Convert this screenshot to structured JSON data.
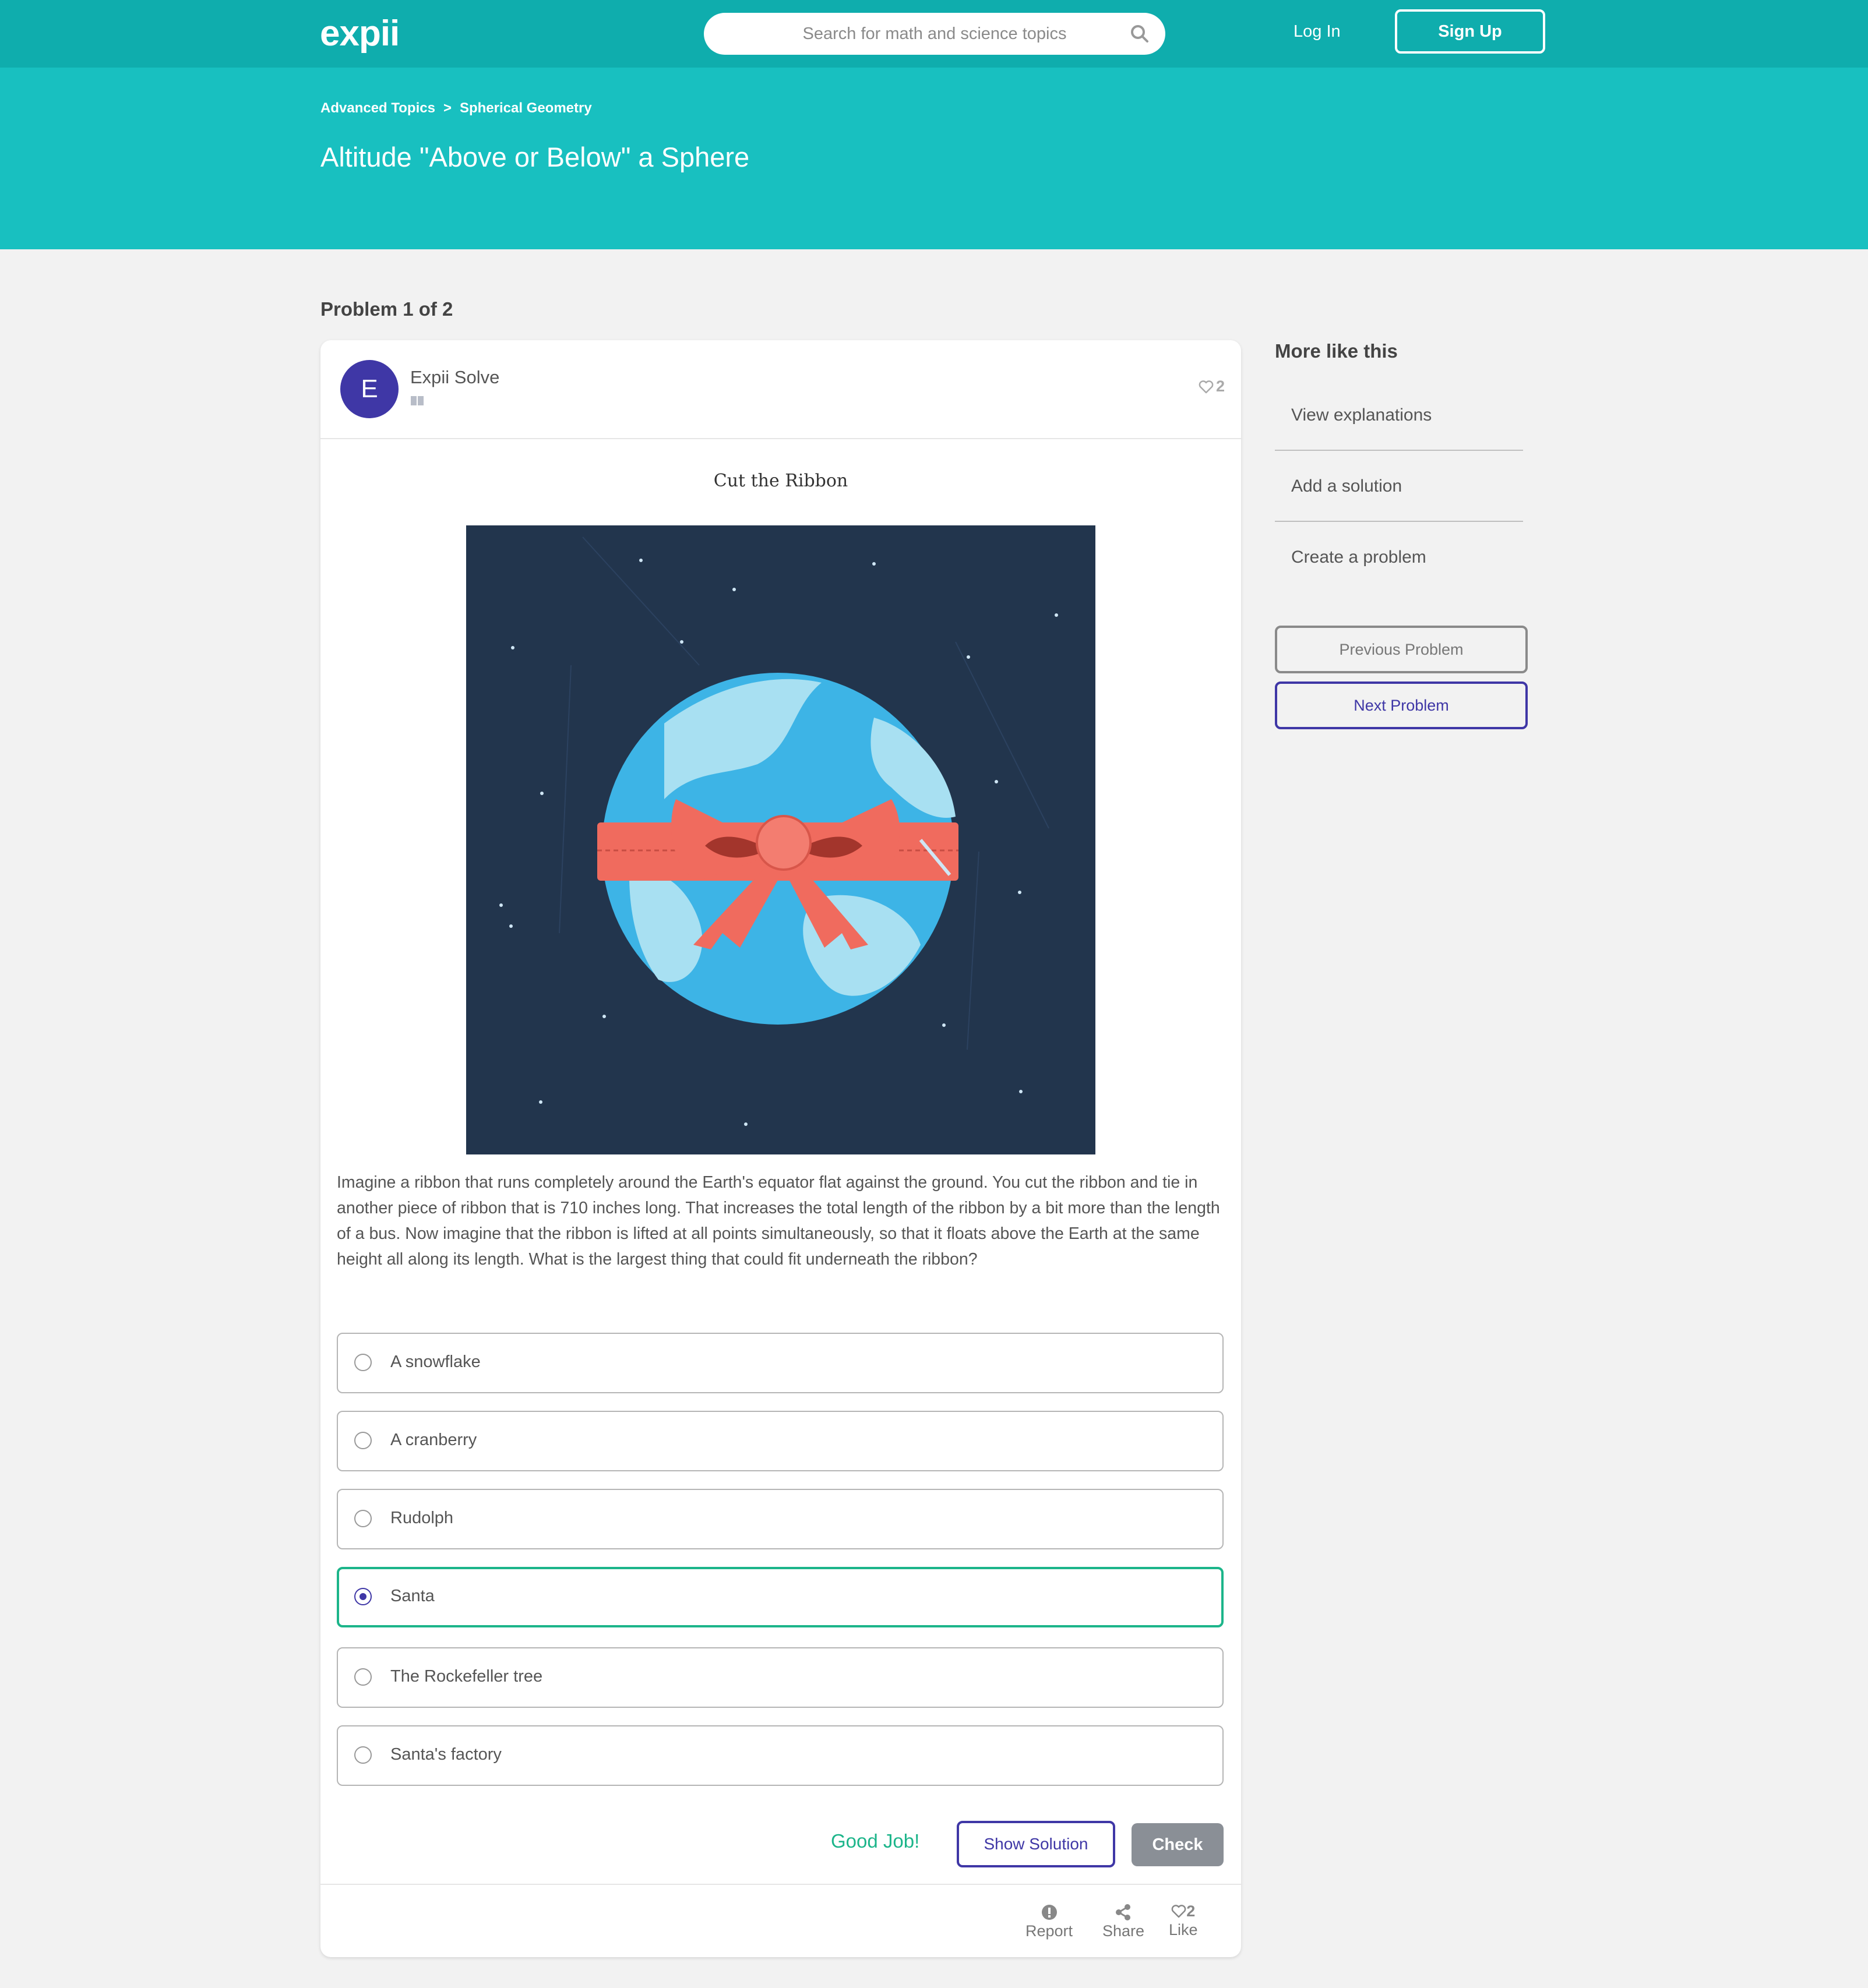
{
  "header": {
    "logo": "expii",
    "search_placeholder": "Search for math and science topics",
    "login": "Log In",
    "signup": "Sign Up"
  },
  "hero": {
    "breadcrumb": [
      "Advanced Topics",
      "Spherical Geometry"
    ],
    "breadcrumb_sep": ">",
    "title": "Altitude \"Above or Below\" a Sphere"
  },
  "problem_label": "Problem 1 of 2",
  "card": {
    "avatar_letter": "E",
    "author": "Expii Solve",
    "like_count": "2",
    "image_title": "Cut the Ribbon",
    "question": "Imagine a ribbon that runs completely around the Earth's equator flat against the ground. You cut the ribbon and tie in another piece of ribbon that is 710 inches long. That increases the total length of the ribbon by a bit more than the length of a bus. Now imagine that the ribbon is lifted at all points simultaneously, so that it floats above the Earth at the same height all along its length. What is the largest thing that could fit underneath the ribbon?",
    "options": [
      {
        "label": "A snowflake",
        "selected": false
      },
      {
        "label": "A cranberry",
        "selected": false
      },
      {
        "label": "Rudolph",
        "selected": false
      },
      {
        "label": "Santa",
        "selected": true
      },
      {
        "label": "The Rockefeller tree",
        "selected": false
      },
      {
        "label": "Santa's factory",
        "selected": false
      }
    ],
    "feedback": "Good Job!",
    "show_solution": "Show Solution",
    "check": "Check",
    "footer": {
      "report": "Report",
      "share": "Share",
      "like": "Like",
      "like_count": "2"
    }
  },
  "sidebar": {
    "title": "More like this",
    "links": [
      "View explanations",
      "Add a solution",
      "Create a problem"
    ],
    "prev": "Previous Problem",
    "next": "Next Problem"
  },
  "colors": {
    "nav": "#0fadad",
    "hero": "#18c0c0",
    "accent_purple": "#3f37a6",
    "success_green": "#1cb58a",
    "illustration_bg": "#22354d",
    "ribbon": "#f06b5e"
  }
}
